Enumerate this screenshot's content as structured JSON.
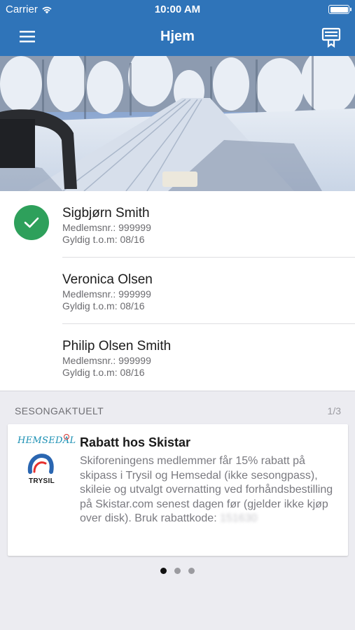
{
  "status_bar": {
    "carrier": "Carrier",
    "time": "10:00 AM"
  },
  "nav": {
    "title": "Hjem"
  },
  "members": [
    {
      "name": "Sigbjørn Smith",
      "member_no": "Medlemsnr.: 999999",
      "valid": "Gyldig t.o.m: 08/16",
      "checked": true
    },
    {
      "name": "Veronica Olsen",
      "member_no": "Medlemsnr.: 999999",
      "valid": "Gyldig t.o.m: 08/16",
      "checked": false
    },
    {
      "name": "Philip Olsen Smith",
      "member_no": "Medlemsnr.: 999999",
      "valid": "Gyldig t.o.m: 08/16",
      "checked": false
    }
  ],
  "seasonal": {
    "header": "SESONGAKTUELT",
    "count": "1/3",
    "card": {
      "logo_top": "HEMSEDAL",
      "logo_bottom": "TRYSIL",
      "title": "Rabatt hos Skistar",
      "body": "Skiforeningens medlemmer får 15% rabatt på skipass i Trysil og Hemsedal (ikke sesongpass), skileie og utvalgt overnatting ved forhåndsbestilling på Skistar.com senest dagen før (gjelder ikke kjøp over disk). Bruk rabattkode: ",
      "code": "151630"
    },
    "pager": {
      "pages": 3,
      "active": 1
    }
  },
  "colors": {
    "primary": "#2f74b9",
    "check": "#2ea05b",
    "background": "#ececf1"
  },
  "icons": [
    "wifi-icon",
    "battery-icon",
    "hamburger-menu-icon",
    "membership-card-icon",
    "checkmark-icon"
  ]
}
